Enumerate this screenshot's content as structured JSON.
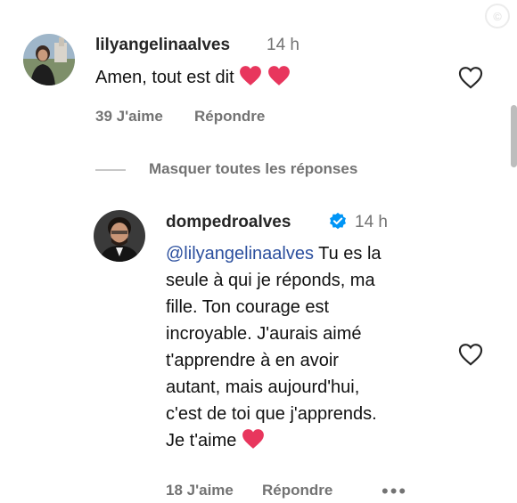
{
  "watermark": "©",
  "comment1": {
    "username": "lilyangelinaalves",
    "time": "14 h",
    "text": "Amen, tout est dit",
    "likes": "39 J'aime",
    "reply_label": "Répondre"
  },
  "hide_replies_label": "Masquer toutes les réponses",
  "comment2": {
    "username": "dompedroalves",
    "time": "14 h",
    "mention": "@lilyangelinaalves",
    "line1": " Tu es la",
    "line2": "seule à qui je réponds, ma",
    "line3": "fille. Ton courage est",
    "line4": "incroyable. J'aurais aimé",
    "line5": "t'apprendre à en avoir",
    "line6": "autant, mais aujourd'hui,",
    "line7": "c'est de toi que j'apprends.",
    "line8": "Je t'aime",
    "likes": "18 J'aime",
    "reply_label": "Répondre"
  },
  "more_label": "•••",
  "colors": {
    "heart": "#e8365d",
    "mention": "#2b4f9e",
    "verified": "#0095f6",
    "secondary_text": "#737373"
  },
  "icons": {
    "like": "heart-outline-icon",
    "verified": "verified-badge-icon",
    "emoji": "red-heart-emoji"
  }
}
